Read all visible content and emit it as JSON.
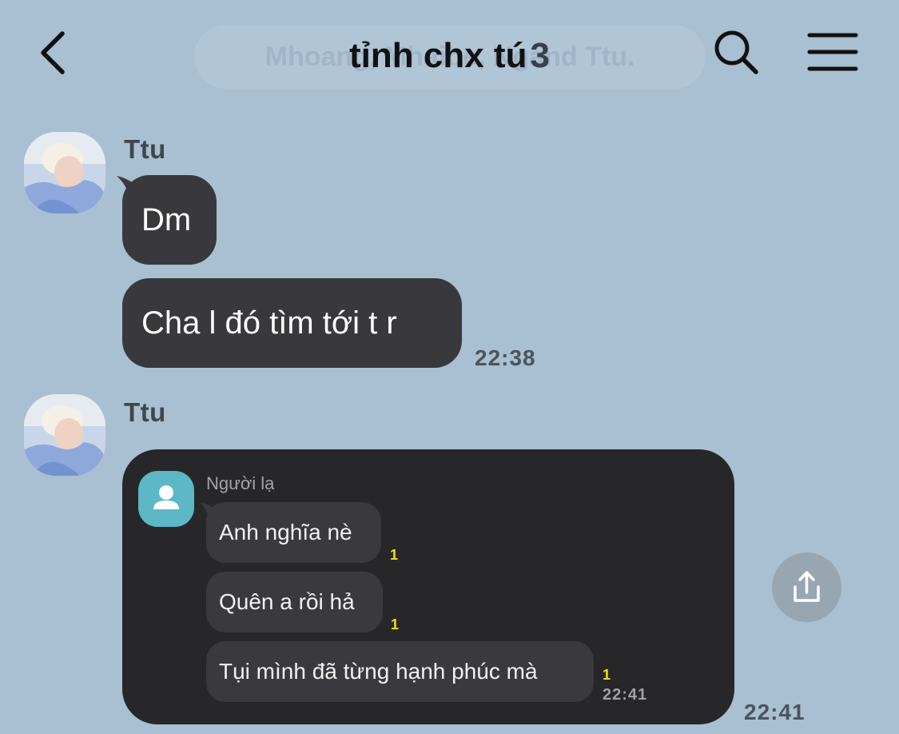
{
  "header": {
    "ghost_text": "Mhoang, Mhaibe, Ngand Ttu.",
    "title": "tỉnh chx tú",
    "member_count": "3",
    "icons": [
      "back-chevron-icon",
      "search-icon",
      "hamburger-menu-icon"
    ]
  },
  "messages": [
    {
      "sender": "Ttu",
      "bubbles": [
        "Dm",
        "Cha l đó tìm tới t r"
      ],
      "time": "22:38"
    },
    {
      "sender": "Ttu",
      "time": "22:41",
      "forwarded": {
        "sender": "Người lạ",
        "bubbles": [
          {
            "text": "Anh nghĩa nè",
            "unread": "1"
          },
          {
            "text": "Quên a rồi hả",
            "unread": "1"
          },
          {
            "text": "Tụi mình đã từng hạnh phúc mà",
            "unread": "1"
          }
        ],
        "time": "22:41"
      }
    }
  ],
  "colors": {
    "background": "#a9bfd2",
    "bubble": "#39393d",
    "card": "#27272a",
    "inner_avatar": "#5bb8c4",
    "unread": "#f3e000"
  },
  "share_icon": "share-upload-icon"
}
